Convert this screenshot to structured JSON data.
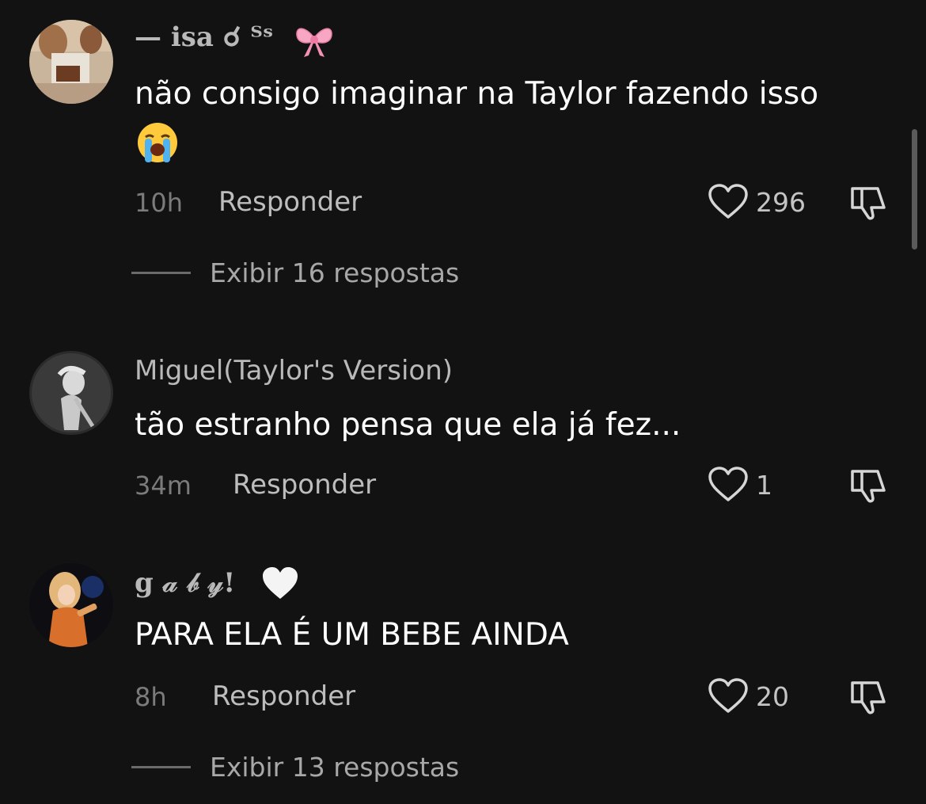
{
  "comments": [
    {
      "username": "— isa ☌ ᵀˢ",
      "text": "não consigo imaginar na Taylor fazendo isso",
      "time": "10h",
      "reply_label": "Responder",
      "like_count": "296",
      "view_replies": "Exibir 16 respostas"
    },
    {
      "username": "Miguel(Taylor's Version)",
      "text": "tão estranho pensa que ela já fez...",
      "time": "34m",
      "reply_label": "Responder",
      "like_count": "1"
    },
    {
      "username": "g 𝒶 𝒷 𝓎!",
      "text": "PARA ELA É UM BEBE AINDA",
      "time": "8h",
      "reply_label": "Responder",
      "like_count": "20",
      "view_replies": "Exibir 13 respostas"
    }
  ],
  "icons": {
    "like": "heart-outline-icon",
    "dislike": "thumbs-down-icon",
    "bow": "pink-bow-emoji",
    "crying": "loudly-crying-face-emoji",
    "white_heart": "white-heart-emoji"
  }
}
